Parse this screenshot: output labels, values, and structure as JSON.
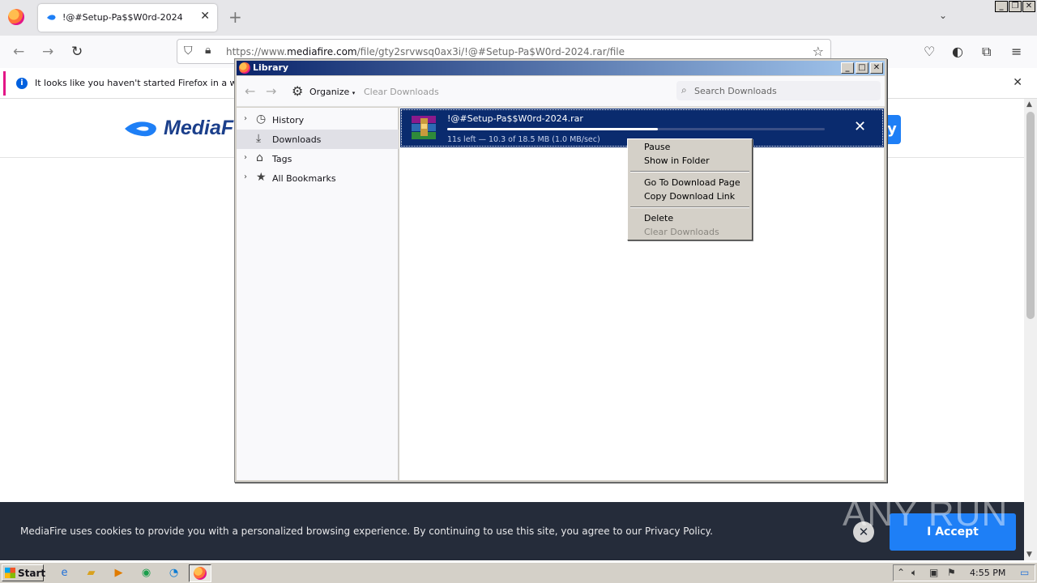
{
  "browser": {
    "tab_title": "!@#Setup-Pa$$W0rd-2024",
    "url_prefix": "https://www.",
    "url_domain": "mediafire.com",
    "url_path": "/file/gty2srvwsq0ax3i/!@#Setup-Pa$W0rd-2024.rar/file",
    "notification_text": "It looks like you haven't started Firefox in a while. D"
  },
  "page": {
    "logo_text": "MediaF",
    "cookie_message": "MediaFire uses cookies to provide you with a personalized browsing experience. By continuing to use this site, you agree to our Privacy Policy.",
    "accept_label": "I Accept",
    "watermark": "ANY RUN"
  },
  "library": {
    "title": "Library",
    "organize_label": "Organize",
    "clear_downloads_label": "Clear Downloads",
    "search_placeholder": "Search Downloads",
    "sidebar": [
      {
        "label": "History",
        "icon": "clock-icon"
      },
      {
        "label": "Downloads",
        "icon": "download-icon"
      },
      {
        "label": "Tags",
        "icon": "tag-icon"
      },
      {
        "label": "All Bookmarks",
        "icon": "star-icon"
      }
    ],
    "download": {
      "filename": "!@#Setup-Pa$$W0rd-2024.rar",
      "status": "11s left — 10.3 of 18.5 MB (1.0 MB/sec)",
      "progress_fraction": 0.557
    }
  },
  "context_menu": {
    "items": [
      {
        "label": "Pause",
        "disabled": false
      },
      {
        "label": "Show in Folder",
        "disabled": false
      },
      {
        "label": "Go To Download Page",
        "disabled": false
      },
      {
        "label": "Copy Download Link",
        "disabled": false
      },
      {
        "label": "Delete",
        "disabled": false
      },
      {
        "label": "Clear Downloads",
        "disabled": true
      }
    ]
  },
  "taskbar": {
    "start_label": "Start",
    "clock": "4:55 PM"
  }
}
